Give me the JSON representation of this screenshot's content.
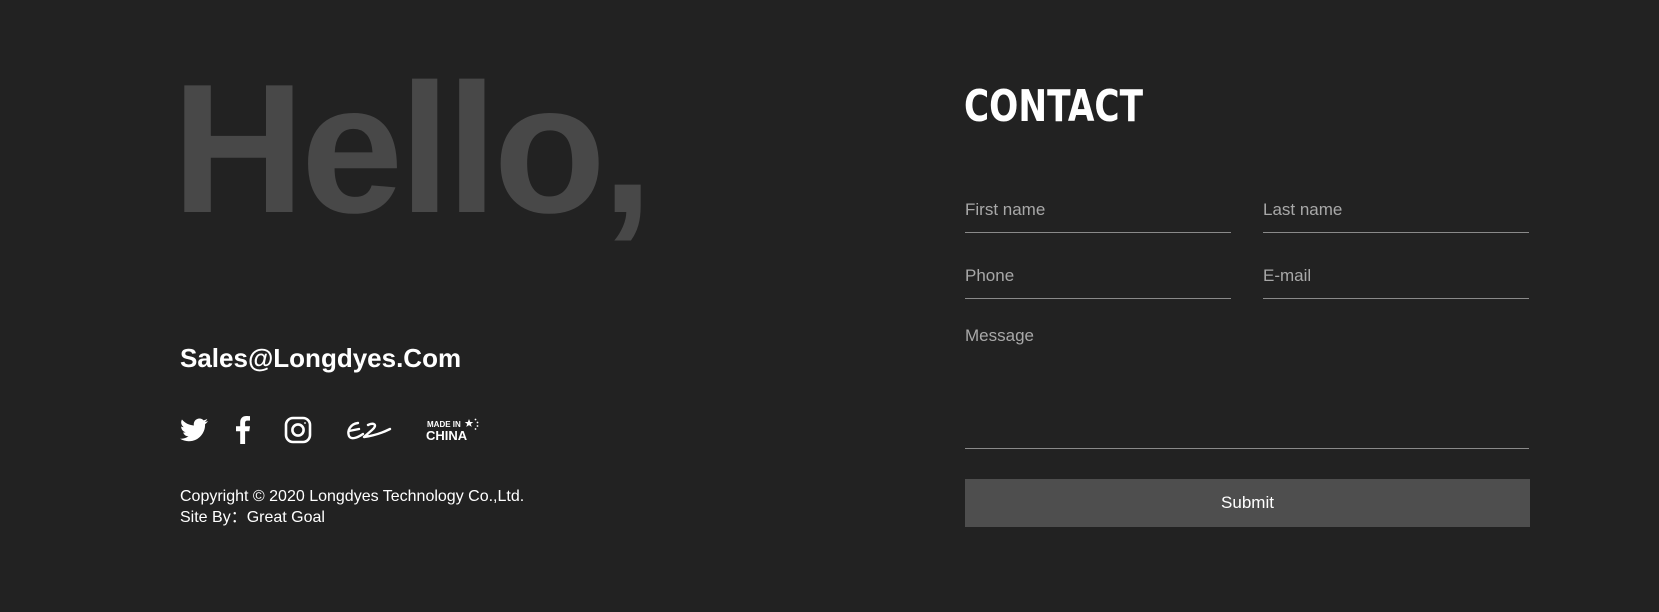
{
  "colors": {
    "background": "#222222",
    "hello_text": "#484848",
    "primary_text": "#ffffff",
    "placeholder_text": "#a8a8a8",
    "field_underline": "#8a8a8a",
    "submit_background": "#4e4e4e"
  },
  "left": {
    "hello": "Hello,",
    "email": "Sales@Longdyes.Com",
    "social": [
      {
        "name": "twitter",
        "icon": "twitter-icon"
      },
      {
        "name": "facebook",
        "icon": "facebook-icon"
      },
      {
        "name": "instagram",
        "icon": "instagram-icon"
      },
      {
        "name": "alibaba",
        "icon": "alibaba-icon"
      },
      {
        "name": "made-in-china",
        "icon": "made-in-china-icon",
        "text_top": "MADE IN",
        "text_bottom": "CHINA"
      }
    ],
    "copyright": "Copyright © 2020 Longdyes Technology Co.,Ltd.",
    "site_by_label": "Site By：",
    "site_by_name": "Great Goal"
  },
  "contact": {
    "title": "CONTACT",
    "form": {
      "first_name": {
        "placeholder": "First name",
        "value": ""
      },
      "last_name": {
        "placeholder": "Last name",
        "value": ""
      },
      "phone": {
        "placeholder": "Phone",
        "value": ""
      },
      "email": {
        "placeholder": "E-mail",
        "value": ""
      },
      "message": {
        "placeholder": "Message",
        "value": ""
      }
    },
    "submit_label": "Submit"
  }
}
